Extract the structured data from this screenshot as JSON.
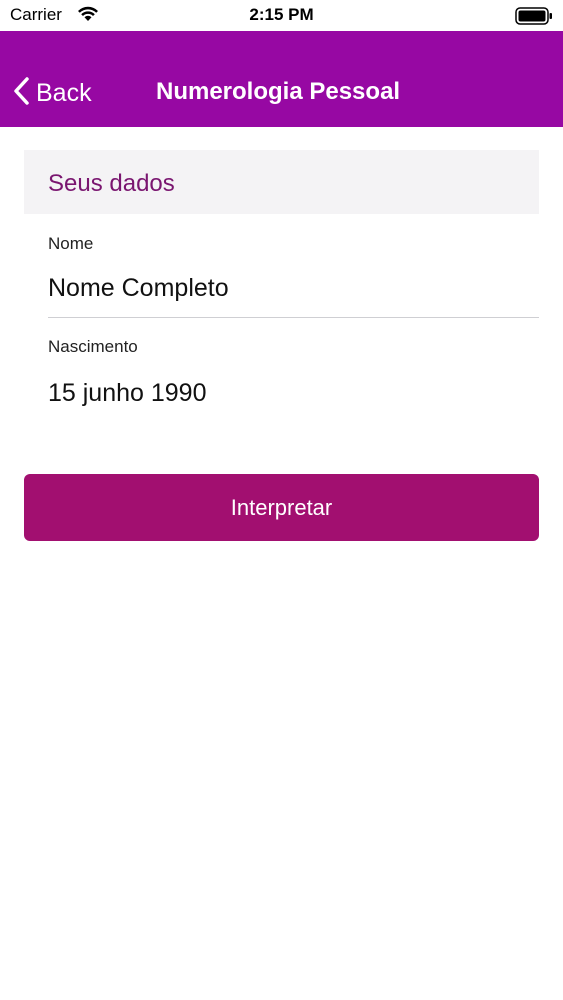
{
  "status_bar": {
    "carrier": "Carrier",
    "time": "2:15 PM",
    "wifi_icon": "wifi-icon",
    "battery_icon": "battery-icon"
  },
  "nav": {
    "back_label": "Back",
    "back_icon": "chevron-left-icon",
    "title": "Numerologia Pessoal",
    "color": "#9708a3"
  },
  "form": {
    "section_title": "Seus dados",
    "name_label": "Nome",
    "name_value": "Nome Completo",
    "birth_label": "Nascimento",
    "birth_value": "15 junho 1990"
  },
  "action": {
    "label": "Interpretar",
    "color": "#a20f70"
  }
}
